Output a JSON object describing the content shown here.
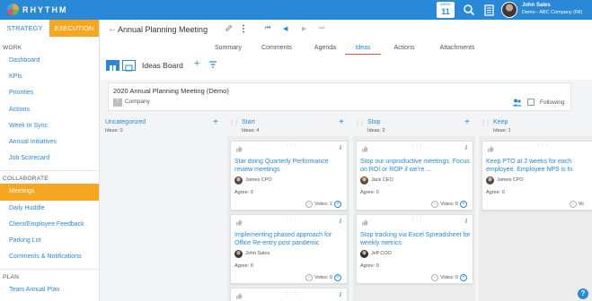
{
  "topbar": {
    "logo_text": "RHYTHM",
    "week_label": "WEEK",
    "week_number": "11",
    "user_name": "John Sales",
    "user_company": "Demo - ABC Company (Ril)"
  },
  "sidebar": {
    "mode_tabs": [
      "STRATEGY",
      "EXECUTION"
    ],
    "sections": [
      {
        "label": "WORK",
        "items": [
          "Dashboard",
          "KPIs",
          "Priorities",
          "Actions",
          "Week In Sync",
          "Annual Initiatives",
          "Job Scorecard"
        ]
      },
      {
        "label": "COLLABORATE",
        "items": [
          "Meetings",
          "Daily Huddle",
          "Client/Employee Feedback",
          "Parking Lot",
          "Comments & Notifications"
        ]
      },
      {
        "label": "PLAN",
        "items": [
          "Team Annual Plan"
        ]
      }
    ]
  },
  "header": {
    "title": "Annual Planning Meeting",
    "tabs": [
      "Summary",
      "Comments",
      "Agenda",
      "Ideas",
      "Actions",
      "Attachments"
    ],
    "active_tab": "Ideas",
    "board_title": "Ideas Board"
  },
  "meeting": {
    "title": "2020 Annual Planning Meeting (Demo)",
    "company_badge": "T",
    "company": "Company",
    "following_label": "Following"
  },
  "columns": [
    {
      "name": "Uncategorized",
      "count": "Ideas: 0",
      "cards": []
    },
    {
      "name": "Start",
      "count": "Ideas: 4",
      "cards": [
        {
          "title": "Star doing Quarterly Performance review meetings",
          "owner": "James CPO",
          "agree": "Agree: 0",
          "votes": "Votes: 1"
        },
        {
          "title": "Implementing phased approach for Office Re-entry post pandemic",
          "owner": "John Sales",
          "agree": "Agree: 0",
          "votes": "Votes: 0"
        }
      ]
    },
    {
      "name": "Stop",
      "count": "Ideas: 2",
      "cards": [
        {
          "title": "Stop our unproductive meetings. Focus on ROI or ROP if we're ...",
          "owner": "Jack CEO",
          "agree": "Agree: 0",
          "votes": "Votes: 0"
        },
        {
          "title": "Stop tracking via Excel Spreadsheet for weekly metrics",
          "owner": "Jeff COO",
          "agree": "Agree: 0",
          "votes": "Votes: 0"
        }
      ]
    },
    {
      "name": "Keep",
      "count": "Ideas: 1",
      "cards": [
        {
          "title": "Keep PTO at 2 weeks for each employee. Employee NPS is hi",
          "owner": "James CPO",
          "agree": "Agree: 0",
          "votes": "Vo"
        }
      ]
    }
  ],
  "colors": {
    "primary": "#2a89d6",
    "accent": "#f5a623",
    "tab_underline": "#e9534f"
  }
}
